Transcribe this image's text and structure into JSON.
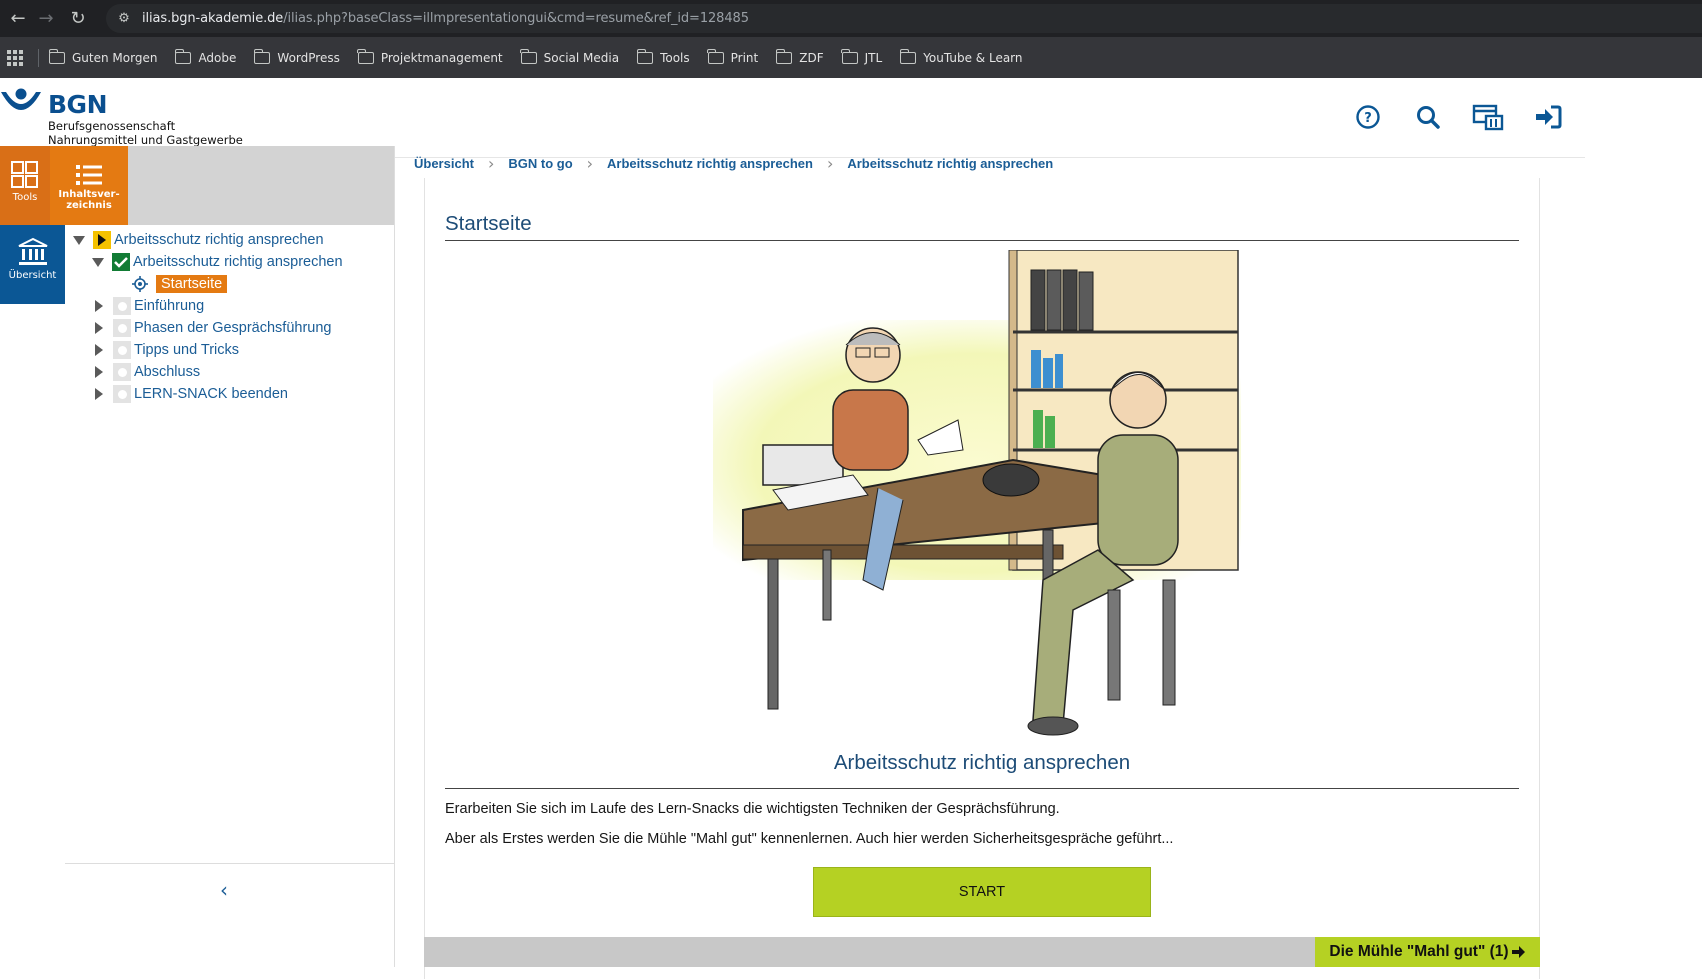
{
  "browser": {
    "url_host": "ilias.bgn-akademie.de",
    "url_path": "/ilias.php?baseClass=illmpresentationgui&cmd=resume&ref_id=128485",
    "bookmarks": [
      "Guten Morgen",
      "Adobe",
      "WordPress",
      "Projektmanagement",
      "Social Media",
      "Tools",
      "Print",
      "ZDF",
      "JTL",
      "YouTube & Learn"
    ]
  },
  "header": {
    "logo_text": "BGN",
    "logo_sub1": "Berufsgenossenschaft",
    "logo_sub2": "Nahrungsmittel und Gastgewerbe"
  },
  "mainbar": {
    "tools": "Tools",
    "toc_line1": "Inhaltsver-",
    "toc_line2": "zeichnis",
    "overview": "Übersicht"
  },
  "tree": {
    "root": "Arbeitsschutz richtig ansprechen",
    "chapter": "Arbeitsschutz richtig ansprechen",
    "current": "Startseite",
    "items": [
      "Einführung",
      "Phasen der Gesprächsführung",
      "Tipps und Tricks",
      "Abschluss",
      "LERN-SNACK beenden"
    ]
  },
  "breadcrumbs": [
    "Übersicht",
    "BGN to go",
    "Arbeitsschutz richtig ansprechen",
    "Arbeitsschutz richtig ansprechen"
  ],
  "content": {
    "page_title": "Startseite",
    "heading": "Arbeitsschutz richtig ansprechen",
    "para1": "Erarbeiten Sie sich im Laufe des Lern-Snacks die wichtigsten Techniken der Gesprächsführung.",
    "para2": "Aber als Erstes werden Sie die Mühle \"Mahl gut\" kennenlernen. Auch hier werden Sicherheitsgespräche geführt...",
    "start_label": "START",
    "next_label": "Die Mühle \"Mahl gut\" (1)"
  },
  "colors": {
    "brand_blue": "#0b5795",
    "brand_orange": "#e47a12",
    "accent_green": "#b5d123"
  }
}
